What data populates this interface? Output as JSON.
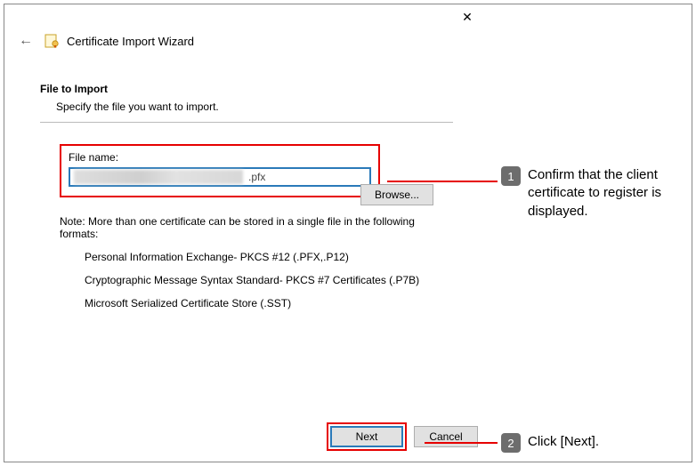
{
  "window": {
    "title": "Certificate Import Wizard",
    "close_glyph": "✕"
  },
  "header": {
    "back_arrow": "←"
  },
  "section": {
    "heading": "File to Import",
    "subtitle": "Specify the file you want to import."
  },
  "file": {
    "label": "File name:",
    "value_visible_suffix": ".pfx",
    "browse_label": "Browse..."
  },
  "note": {
    "intro": "Note:  More than one certificate can be stored in a single file in the following formats:",
    "items": [
      "Personal Information Exchange- PKCS #12 (.PFX,.P12)",
      "Cryptographic Message Syntax Standard- PKCS #7 Certificates (.P7B)",
      "Microsoft Serialized Certificate Store (.SST)"
    ]
  },
  "buttons": {
    "next": "Next",
    "cancel": "Cancel"
  },
  "annotations": {
    "one": {
      "num": "1",
      "text": "Confirm that the client certificate to register is displayed."
    },
    "two": {
      "num": "2",
      "text": "Click [Next]."
    }
  }
}
